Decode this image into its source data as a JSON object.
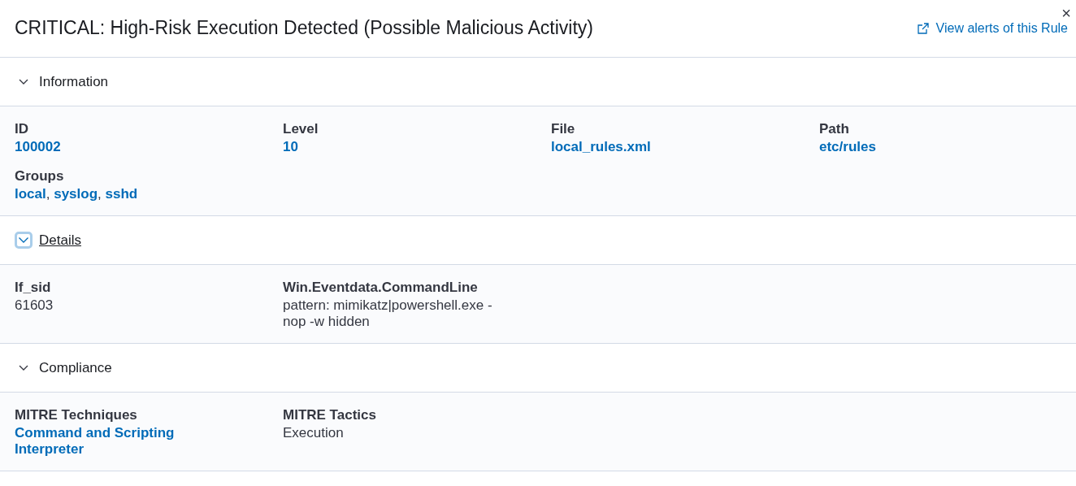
{
  "title": "CRITICAL: High-Risk Execution Detected (Possible Malicious Activity)",
  "header_link": "View alerts of this Rule",
  "close": "×",
  "sections": [
    {
      "title": "Information",
      "focused": false,
      "expanded": true,
      "fields": [
        {
          "label": "ID",
          "kind": "link",
          "values": [
            "100002"
          ]
        },
        {
          "label": "Level",
          "kind": "link",
          "values": [
            "10"
          ]
        },
        {
          "label": "File",
          "kind": "link",
          "values": [
            "local_rules.xml"
          ]
        },
        {
          "label": "Path",
          "kind": "link",
          "values": [
            "etc/rules"
          ]
        },
        {
          "label": "Groups",
          "kind": "link",
          "values": [
            "local",
            "syslog",
            "sshd"
          ],
          "separator": ", "
        }
      ]
    },
    {
      "title": "Details",
      "focused": true,
      "expanded": true,
      "fields": [
        {
          "label": "If_sid",
          "kind": "text",
          "values": [
            "61603"
          ]
        },
        {
          "label": "Win.Eventdata.CommandLine",
          "kind": "text",
          "values": [
            "pattern: mimikatz|powershell.exe -nop -w hidden"
          ]
        }
      ]
    },
    {
      "title": "Compliance",
      "focused": false,
      "expanded": true,
      "fields": [
        {
          "label": "MITRE Techniques",
          "kind": "link",
          "values": [
            "Command and Scripting Interpreter"
          ]
        },
        {
          "label": "MITRE Tactics",
          "kind": "text",
          "values": [
            "Execution"
          ]
        }
      ]
    }
  ]
}
